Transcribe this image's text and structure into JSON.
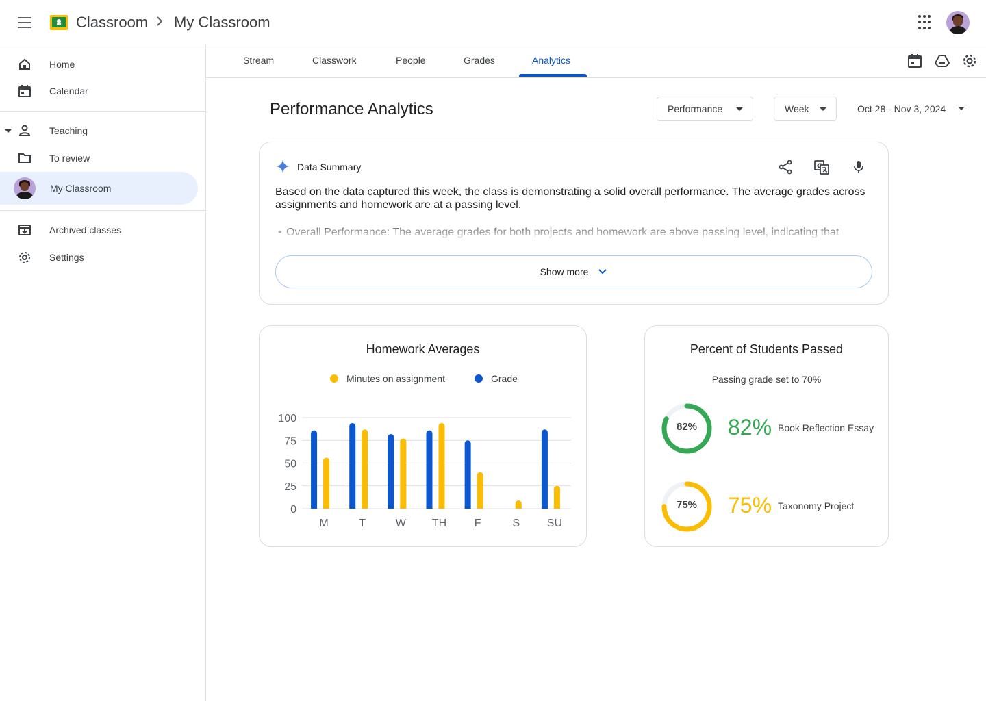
{
  "header": {
    "app_title": "Classroom",
    "breadcrumb_current": "My Classroom",
    "icons": [
      "menu-icon",
      "classroom-logo-icon",
      "chevron-right-icon",
      "apps-grid-icon",
      "avatar"
    ]
  },
  "sidebar": {
    "items": [
      {
        "label": "Home",
        "icon": "home-icon"
      },
      {
        "label": "Calendar",
        "icon": "calendar-icon"
      },
      {
        "label": "Teaching",
        "icon": "person-icon"
      },
      {
        "label": "To review",
        "icon": "folder-icon"
      },
      {
        "label": "My Classroom",
        "icon": "avatar"
      },
      {
        "label": "Archived classes",
        "icon": "archive-icon"
      },
      {
        "label": "Settings",
        "icon": "gear-icon"
      }
    ]
  },
  "tabs": [
    {
      "label": "Stream"
    },
    {
      "label": "Classwork"
    },
    {
      "label": "People"
    },
    {
      "label": "Grades"
    },
    {
      "label": "Analytics"
    }
  ],
  "active_tab": "Analytics",
  "page": {
    "title": "Performance Analytics",
    "metric_dropdown": "Performance",
    "period_dropdown": "Week",
    "date_range": "Oct 28 - Nov 3, 2024"
  },
  "summary": {
    "title": "Data Summary",
    "text": "Based on the data captured this week, the class is demonstrating a solid overall performance. The average grades across assignments and homework are at a passing level.",
    "bullet": "Overall Performance: The average grades for both projects and homework are above passing level, indicating that",
    "show_more": "Show more"
  },
  "colors": {
    "accent": "#0b57d0",
    "grade_series": "#0b57d0",
    "minutes_series": "#fbbc04",
    "pass_green": "#34a853",
    "pass_yellow": "#fbbc04"
  },
  "homework_chart": {
    "title": "Homework Averages",
    "legend": [
      "Minutes on assignment",
      "Grade"
    ]
  },
  "chart_data": [
    {
      "type": "bar",
      "title": "Homework Averages",
      "categories": [
        "M",
        "T",
        "W",
        "TH",
        "F",
        "S",
        "SU"
      ],
      "series": [
        {
          "name": "Grade",
          "values": [
            86,
            94,
            82,
            86,
            75,
            0,
            87
          ]
        },
        {
          "name": "Minutes on assignment",
          "values": [
            56,
            87,
            77,
            94,
            40,
            9,
            25
          ]
        }
      ],
      "yticks": [
        100,
        75,
        50,
        25,
        0
      ],
      "ylim": [
        0,
        100
      ],
      "grid": true,
      "legend_position": "top"
    }
  ],
  "pass_card": {
    "title": "Percent of Students Passed",
    "subtitle": "Passing grade set to 70%",
    "items": [
      {
        "value": 82,
        "ring_label": "82%",
        "big_label": "82%",
        "name": "Book Reflection Essay",
        "color": "#34a853"
      },
      {
        "value": 75,
        "ring_label": "75%",
        "big_label": "75%",
        "name": "Taxonomy Project",
        "color": "#fbbc04"
      }
    ]
  }
}
